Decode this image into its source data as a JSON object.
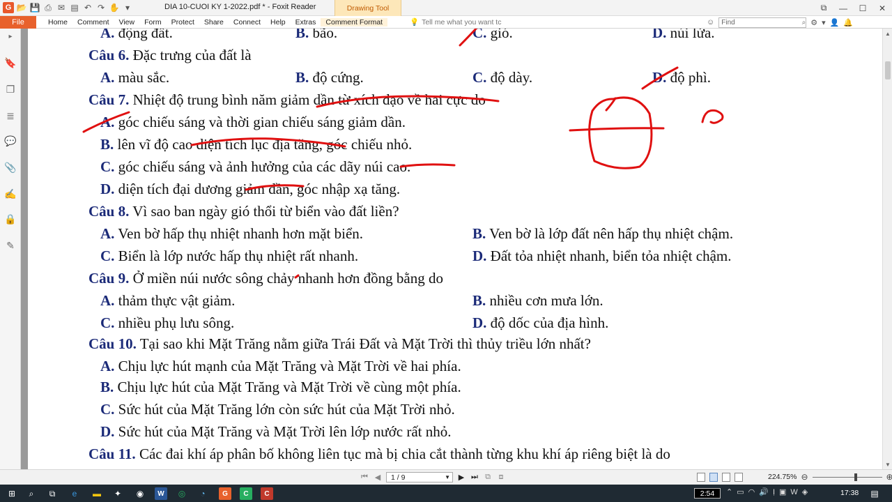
{
  "window": {
    "title": "DIA 10-CUOI KY 1-2022.pdf * - Foxit Reader",
    "context_tab": "Drawing Tool",
    "app_logo": "G"
  },
  "ribbon": {
    "file_tab": "File",
    "tabs": [
      "Home",
      "Comment",
      "View",
      "Form",
      "Protect",
      "Share",
      "Connect",
      "Help",
      "Extras",
      "Comment Format"
    ],
    "tell_me": "Tell me what you want tc",
    "find_placeholder": "Find"
  },
  "document": {
    "lines": [
      {
        "opts": [
          {
            "label": "A.",
            "text": " động đất."
          },
          {
            "label": "B.",
            "text": " bão."
          },
          {
            "label": "C.",
            "text": " gió."
          },
          {
            "label": "D.",
            "text": " núi lửa."
          }
        ]
      },
      {
        "q": {
          "label": "Câu 6.",
          "text": " Đặc trưng của đất là"
        }
      },
      {
        "opts": [
          {
            "label": "A.",
            "text": " màu sắc."
          },
          {
            "label": "B.",
            "text": " độ cứng."
          },
          {
            "label": "C.",
            "text": " độ dày."
          },
          {
            "label": "D.",
            "text": " độ phì."
          }
        ]
      },
      {
        "q": {
          "label": "Câu 7.",
          "text": " Nhiệt độ trung bình năm giảm dần từ xích đạo về hai cực do"
        }
      },
      {
        "opts": [
          {
            "label": "A.",
            "text": " góc chiếu sáng và thời gian chiếu sáng giảm dần."
          }
        ]
      },
      {
        "opts": [
          {
            "label": "B.",
            "text": " lên vĩ độ cao diện tích lục địa tăng, góc chiếu nhỏ."
          }
        ]
      },
      {
        "opts": [
          {
            "label": "C.",
            "text": " góc chiếu sáng và ảnh hưởng của các dãy núi cao."
          }
        ]
      },
      {
        "opts": [
          {
            "label": "D.",
            "text": " diện tích đại dương giảm dần, góc nhập xạ tăng."
          }
        ]
      },
      {
        "q": {
          "label": "Câu 8.",
          "text": " Vì sao ban ngày gió thổi từ biển vào đất liền?"
        }
      },
      {
        "opts": [
          {
            "label": "A.",
            "text": " Ven bờ hấp thụ nhiệt nhanh hơn mặt biển."
          },
          {
            "label": "B.",
            "text": " Ven bờ là lớp đất nên hấp thụ nhiệt chậm."
          }
        ]
      },
      {
        "opts": [
          {
            "label": "C.",
            "text": " Biển là lớp nước hấp thụ nhiệt rất nhanh."
          },
          {
            "label": "D.",
            "text": " Đất tỏa nhiệt nhanh, biển tỏa nhiệt chậm."
          }
        ]
      },
      {
        "q": {
          "label": "Câu 9.",
          "text": " Ở miền núi nước sông chảy nhanh hơn đồng bằng do"
        }
      },
      {
        "opts": [
          {
            "label": "A.",
            "text": " thảm thực vật giảm."
          },
          {
            "label": "B.",
            "text": " nhiều cơn mưa lớn."
          }
        ]
      },
      {
        "opts": [
          {
            "label": "C.",
            "text": " nhiều phụ lưu sông."
          },
          {
            "label": "D.",
            "text": " độ dốc của địa hình."
          }
        ]
      },
      {
        "q": {
          "label": "Câu 10.",
          "text": " Tại sao khi Mặt Trăng nằm giữa Trái Đất và Mặt Trời thì thủy triều lớn nhất?"
        }
      },
      {
        "opts": [
          {
            "label": "A.",
            "text": " Chịu lực hút mạnh của Mặt Trăng và Mặt Trời về hai phía."
          }
        ]
      },
      {
        "opts": [
          {
            "label": "B.",
            "text": " Chịu lực hút của Mặt Trăng và Mặt Trời về cùng một phía."
          }
        ]
      },
      {
        "opts": [
          {
            "label": "C.",
            "text": " Sức hút của Mặt Trăng lớn còn sức hút của Mặt Trời nhỏ."
          }
        ]
      },
      {
        "opts": [
          {
            "label": "D.",
            "text": " Sức hút của Mặt Trăng và Mặt Trời lên lớp nước rất nhỏ."
          }
        ]
      },
      {
        "q": {
          "label": "Câu 11.",
          "text": " Các đai khí áp phân bố không liên tục mà bị chia cắt thành từng khu khí áp riêng biệt là do"
        }
      }
    ]
  },
  "statusbar": {
    "page_indicator": "1 / 9",
    "zoom": "224.75%",
    "zoom_level": 0.62
  },
  "taskbar": {
    "clock_box": "2:54",
    "time": "17:38"
  },
  "colors": {
    "accent": "#e8612c",
    "label_blue": "#1b2a78",
    "annotation_red": "#e01010",
    "taskbar": "#1f2a33"
  }
}
